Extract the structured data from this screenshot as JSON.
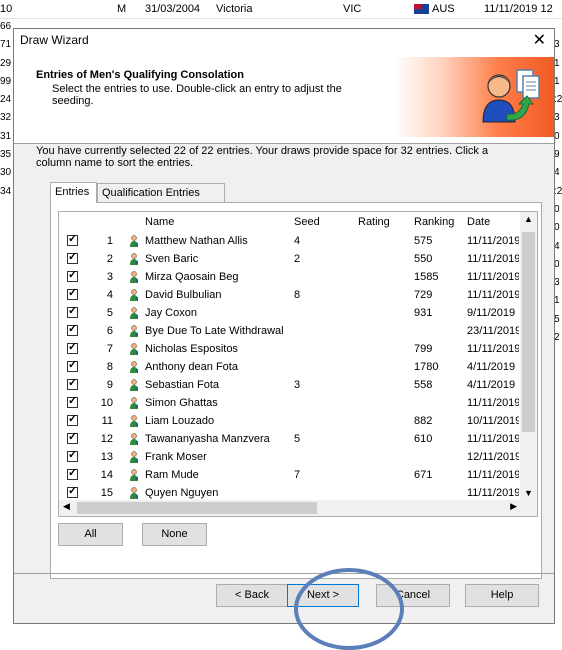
{
  "background_sheet": {
    "top_row": {
      "col_a": "10",
      "gender": "M",
      "dob": "31/03/2004",
      "state_name": "Victoria",
      "state": "VIC",
      "country": "AUS",
      "date": "11/11/2019 12"
    },
    "left_numbers": [
      "66",
      "71",
      "29",
      "99",
      "24",
      "32",
      "31",
      "35",
      "30",
      "34"
    ],
    "right_numbers": [
      "",
      "3",
      "1",
      "1",
      ":2",
      "3",
      "0",
      "9",
      "4",
      ":2",
      "0",
      "0",
      "4",
      "0",
      "3",
      "1",
      "5",
      "2"
    ]
  },
  "dialog": {
    "title": "Draw Wizard",
    "close_glyph": "✕",
    "header_title": "Entries of Men's Qualifying Consolation",
    "header_subtitle": "Select the entries to use. Double-click an entry to adjust the seeding.",
    "selection_text": "You have currently selected 22 of 22 entries. Your draws provide space for 32 entries. Click a column name to sort the entries.",
    "tabs": [
      {
        "label": "Entries",
        "active": true
      },
      {
        "label": "Qualification Entries",
        "active": false
      }
    ],
    "columns": {
      "name": "Name",
      "seed": "Seed",
      "rating": "Rating",
      "ranking": "Ranking",
      "date": "Date"
    },
    "rows": [
      {
        "num": "1",
        "name": "Matthew Nathan Allis",
        "seed": "4",
        "ranking": "575",
        "date": "11/11/2019"
      },
      {
        "num": "2",
        "name": "Sven Baric",
        "seed": "2",
        "ranking": "550",
        "date": "11/11/2019"
      },
      {
        "num": "3",
        "name": "Mirza Qaosain Beg",
        "seed": "",
        "ranking": "1585",
        "date": "11/11/2019"
      },
      {
        "num": "4",
        "name": "David Bulbulian",
        "seed": "8",
        "ranking": "729",
        "date": "11/11/2019"
      },
      {
        "num": "5",
        "name": "Jay Coxon",
        "seed": "",
        "ranking": "931",
        "date": "9/11/2019"
      },
      {
        "num": "6",
        "name": "Bye Due To Late Withdrawal",
        "seed": "",
        "ranking": "",
        "date": "23/11/2019"
      },
      {
        "num": "7",
        "name": "Nicholas Espositos",
        "seed": "",
        "ranking": "799",
        "date": "11/11/2019"
      },
      {
        "num": "8",
        "name": "Anthony dean Fota",
        "seed": "",
        "ranking": "1780",
        "date": "4/11/2019"
      },
      {
        "num": "9",
        "name": "Sebastian Fota",
        "seed": "3",
        "ranking": "558",
        "date": "4/11/2019"
      },
      {
        "num": "10",
        "name": "Simon Ghattas",
        "seed": "",
        "ranking": "",
        "date": "11/11/2019"
      },
      {
        "num": "11",
        "name": "Liam Louzado",
        "seed": "",
        "ranking": "882",
        "date": "10/11/2019"
      },
      {
        "num": "12",
        "name": "Tawananyasha Manzvera",
        "seed": "5",
        "ranking": "610",
        "date": "11/11/2019"
      },
      {
        "num": "13",
        "name": "Frank Moser",
        "seed": "",
        "ranking": "",
        "date": "12/11/2019"
      },
      {
        "num": "14",
        "name": "Ram Mude",
        "seed": "7",
        "ranking": "671",
        "date": "11/11/2019"
      },
      {
        "num": "15",
        "name": "Quyen Nguyen",
        "seed": "",
        "ranking": "",
        "date": "11/11/2019"
      }
    ],
    "buttons": {
      "all": "All",
      "none": "None",
      "back": "< Back",
      "next": "Next >",
      "cancel": "Cancel",
      "help": "Help"
    }
  }
}
